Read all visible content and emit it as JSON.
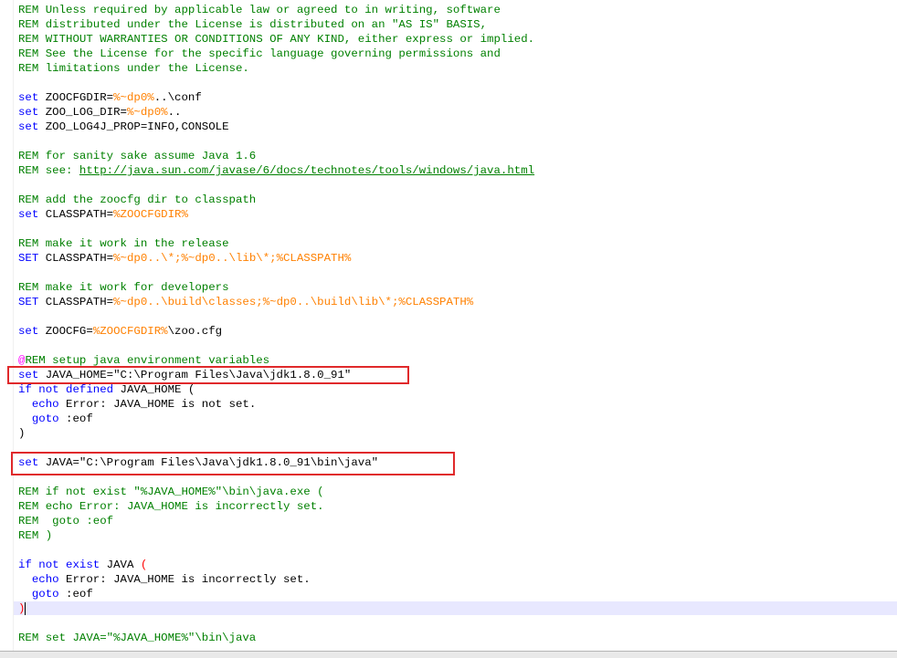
{
  "editor": {
    "lines": [
      {
        "row": 0,
        "segs": [
          {
            "t": "REM Unless required by applicable law or agreed to in writing, software",
            "c": "c"
          }
        ]
      },
      {
        "row": 1,
        "segs": [
          {
            "t": "REM distributed under the License is distributed on an \"AS IS\" BASIS,",
            "c": "c"
          }
        ]
      },
      {
        "row": 2,
        "segs": [
          {
            "t": "REM WITHOUT WARRANTIES OR CONDITIONS OF ANY KIND, either express or implied.",
            "c": "c"
          }
        ]
      },
      {
        "row": 3,
        "segs": [
          {
            "t": "REM See the License for the specific language governing permissions and",
            "c": "c"
          }
        ]
      },
      {
        "row": 4,
        "segs": [
          {
            "t": "REM limitations under the License.",
            "c": "c"
          }
        ]
      },
      {
        "row": 6,
        "segs": [
          {
            "t": "set",
            "c": "k"
          },
          {
            "t": " ZOOCFGDIR=",
            "c": "t"
          },
          {
            "t": "%~dp0%",
            "c": "v"
          },
          {
            "t": "..\\conf",
            "c": "t"
          }
        ]
      },
      {
        "row": 7,
        "segs": [
          {
            "t": "set",
            "c": "k"
          },
          {
            "t": " ZOO_LOG_DIR=",
            "c": "t"
          },
          {
            "t": "%~dp0%",
            "c": "v"
          },
          {
            "t": "..",
            "c": "t"
          }
        ]
      },
      {
        "row": 8,
        "segs": [
          {
            "t": "set",
            "c": "k"
          },
          {
            "t": " ZOO_LOG4J_PROP=INFO,CONSOLE",
            "c": "t"
          }
        ]
      },
      {
        "row": 10,
        "segs": [
          {
            "t": "REM for sanity sake assume Java 1.6",
            "c": "c"
          }
        ]
      },
      {
        "row": 11,
        "segs": [
          {
            "t": "REM see: ",
            "c": "c"
          },
          {
            "t": "http://java.sun.com/javase/6/docs/technotes/tools/windows/java.html",
            "c": "cu"
          }
        ]
      },
      {
        "row": 13,
        "segs": [
          {
            "t": "REM add the zoocfg dir to classpath",
            "c": "c"
          }
        ]
      },
      {
        "row": 14,
        "segs": [
          {
            "t": "set",
            "c": "k"
          },
          {
            "t": " CLASSPATH=",
            "c": "t"
          },
          {
            "t": "%ZOOCFGDIR%",
            "c": "v"
          }
        ]
      },
      {
        "row": 16,
        "segs": [
          {
            "t": "REM make it work in the release",
            "c": "c"
          }
        ]
      },
      {
        "row": 17,
        "segs": [
          {
            "t": "SET",
            "c": "k"
          },
          {
            "t": " CLASSPATH=",
            "c": "t"
          },
          {
            "t": "%~dp0..\\*;%~dp0..\\lib\\*;%CLASSPATH%",
            "c": "v"
          }
        ]
      },
      {
        "row": 19,
        "segs": [
          {
            "t": "REM make it work for developers",
            "c": "c"
          }
        ]
      },
      {
        "row": 20,
        "segs": [
          {
            "t": "SET",
            "c": "k"
          },
          {
            "t": " CLASSPATH=",
            "c": "t"
          },
          {
            "t": "%~dp0..\\build\\classes;%~dp0..\\build\\lib\\*;%CLASSPATH%",
            "c": "v"
          }
        ]
      },
      {
        "row": 22,
        "segs": [
          {
            "t": "set",
            "c": "k"
          },
          {
            "t": " ZOOCFG=",
            "c": "t"
          },
          {
            "t": "%ZOOCFGDIR%",
            "c": "v"
          },
          {
            "t": "\\zoo.cfg",
            "c": "t"
          }
        ]
      },
      {
        "row": 24,
        "segs": [
          {
            "t": "@",
            "c": "at"
          },
          {
            "t": "REM setup java environment variables",
            "c": "c"
          }
        ]
      },
      {
        "row": 25,
        "segs": [
          {
            "t": "set",
            "c": "k"
          },
          {
            "t": " JAVA_HOME=\"C:\\Program Files\\Java\\jdk1.8.0_91\"",
            "c": "t"
          }
        ]
      },
      {
        "row": 26,
        "segs": [
          {
            "t": "if not defined",
            "c": "k"
          },
          {
            "t": " JAVA_HOME (",
            "c": "t"
          }
        ]
      },
      {
        "row": 27,
        "segs": [
          {
            "t": "  ",
            "c": "t"
          },
          {
            "t": "echo",
            "c": "k"
          },
          {
            "t": " Error: JAVA_HOME is not set.",
            "c": "t"
          }
        ]
      },
      {
        "row": 28,
        "segs": [
          {
            "t": "  ",
            "c": "t"
          },
          {
            "t": "goto",
            "c": "k"
          },
          {
            "t": " :eof",
            "c": "t"
          }
        ]
      },
      {
        "row": 29,
        "segs": [
          {
            "t": ")",
            "c": "t"
          }
        ]
      },
      {
        "row": 31,
        "segs": [
          {
            "t": "set",
            "c": "k"
          },
          {
            "t": " JAVA=\"C:\\Program Files\\Java\\jdk1.8.0_91\\bin\\java\"",
            "c": "t"
          }
        ]
      },
      {
        "row": 33,
        "segs": [
          {
            "t": "REM if not exist \"%JAVA_HOME%\"\\bin\\java.exe (",
            "c": "c"
          }
        ]
      },
      {
        "row": 34,
        "segs": [
          {
            "t": "REM echo Error: JAVA_HOME is incorrectly set.",
            "c": "c"
          }
        ]
      },
      {
        "row": 35,
        "segs": [
          {
            "t": "REM  goto :eof",
            "c": "c"
          }
        ]
      },
      {
        "row": 36,
        "segs": [
          {
            "t": "REM )",
            "c": "c"
          }
        ]
      },
      {
        "row": 38,
        "segs": [
          {
            "t": "if not exist",
            "c": "k"
          },
          {
            "t": " JAVA ",
            "c": "t"
          },
          {
            "t": "(",
            "c": "pr"
          }
        ]
      },
      {
        "row": 39,
        "segs": [
          {
            "t": "  ",
            "c": "t"
          },
          {
            "t": "echo",
            "c": "k"
          },
          {
            "t": " Error: JAVA_HOME is incorrectly set.",
            "c": "t"
          }
        ]
      },
      {
        "row": 40,
        "segs": [
          {
            "t": "  ",
            "c": "t"
          },
          {
            "t": "goto",
            "c": "k"
          },
          {
            "t": " :eof",
            "c": "t"
          }
        ]
      },
      {
        "row": 41,
        "segs": [
          {
            "t": ")",
            "c": "pr"
          }
        ]
      },
      {
        "row": 43,
        "segs": [
          {
            "t": "REM set JAVA=\"%JAVA_HOME%\"\\bin\\java",
            "c": "c"
          }
        ]
      }
    ],
    "highlight_color": "#e0292b",
    "current_line_color": "#e8e8ff"
  }
}
